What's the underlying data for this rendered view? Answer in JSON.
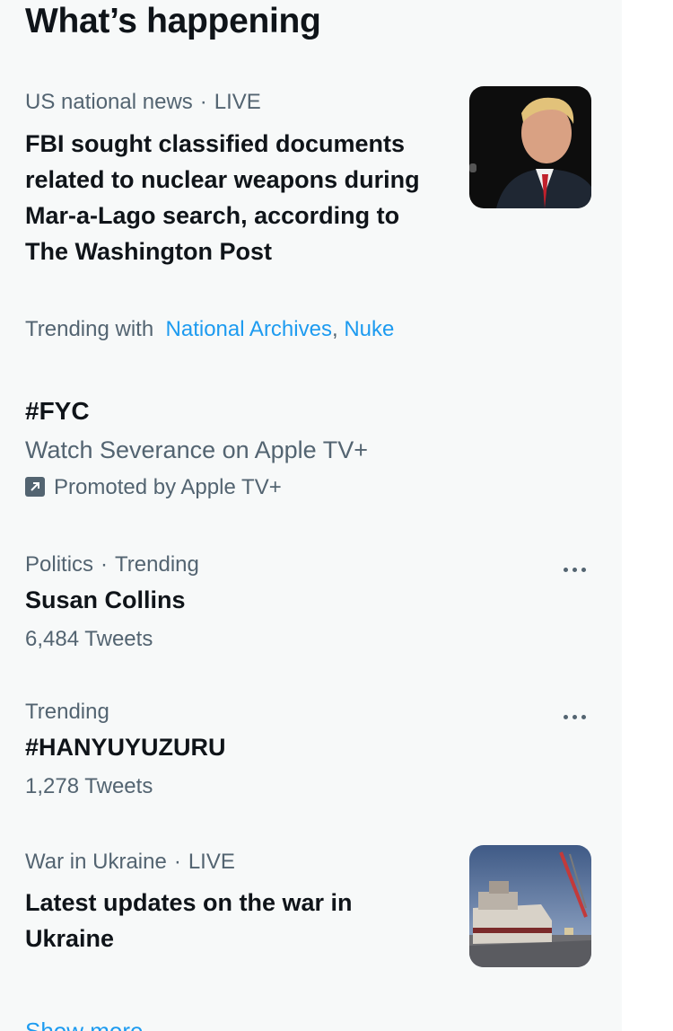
{
  "section": {
    "heading": "What’s happening",
    "show_more_label": "Show more"
  },
  "trends": [
    {
      "meta_category": "US national news",
      "meta_status": "LIVE",
      "title": "FBI sought classified documents related to nuclear weapons during Mar-a-Lago search, according to The Washington Post",
      "trending_with_label": "Trending with",
      "trending_with_links": [
        "National Archives",
        "Nuke"
      ],
      "thumbnail": "news-photo"
    },
    {
      "title": "#FYC",
      "description": "Watch Severance on Apple TV+",
      "promoted_label": "Promoted by Apple TV+",
      "icon": "promoted-icon"
    },
    {
      "meta_category": "Politics",
      "meta_status": "Trending",
      "title": "Susan Collins",
      "count": "6,484 Tweets",
      "icon": "more-icon"
    },
    {
      "meta_category": "Trending",
      "title": "#HANYUYUZURU",
      "count": "1,278 Tweets",
      "icon": "more-icon"
    },
    {
      "meta_category": "War in Ukraine",
      "meta_status": "LIVE",
      "title": "Latest updates on the war in Ukraine",
      "thumbnail": "ship-photo"
    }
  ],
  "colors": {
    "panel_bg": "#f7f9f9",
    "text_primary": "#0f1419",
    "text_secondary": "#536471",
    "link": "#1d9bf0"
  }
}
